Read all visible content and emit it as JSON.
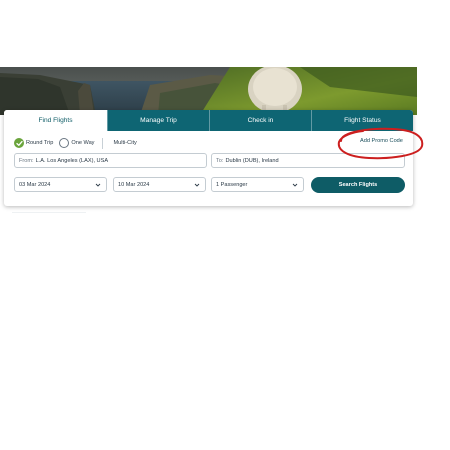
{
  "tabs": [
    {
      "label": "Find Flights",
      "active": true
    },
    {
      "label": "Manage Trip",
      "active": false
    },
    {
      "label": "Check in",
      "active": false
    },
    {
      "label": "Flight Status",
      "active": false
    }
  ],
  "trip_type": {
    "round_trip": "Round Trip",
    "one_way": "One Way",
    "multi_city": "Multi-City",
    "selected": "Round Trip"
  },
  "promo_link": "Add Promo Code",
  "origin": {
    "label": "From:",
    "value": "L.A. Los Angeles (LAX), USA"
  },
  "destination": {
    "label": "To:",
    "value": "Dublin (DUB), Ireland"
  },
  "depart_date": "03 Mar 2024",
  "return_date": "10 Mar 2024",
  "passengers": "1 Passenger",
  "search_button": "Search Flights",
  "colors": {
    "tab_teal": "#0e6573",
    "button_teal": "#0e5c66",
    "check_green": "#6aa43c",
    "annotation_red": "#cc1f1f"
  }
}
